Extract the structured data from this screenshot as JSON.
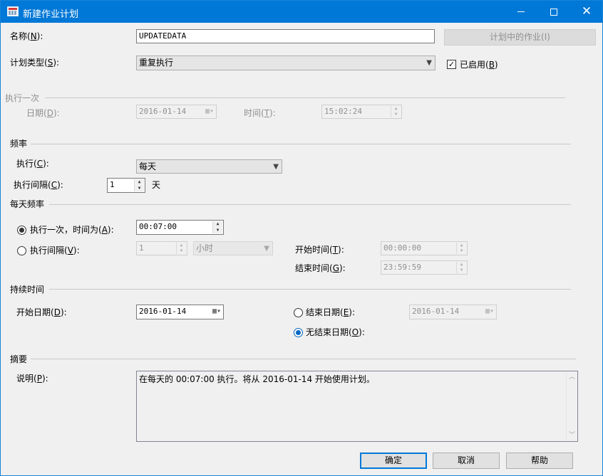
{
  "window": {
    "title": "新建作业计划",
    "minimize": "—",
    "maximize": "□",
    "close": "✕"
  },
  "name": {
    "label": "名称(",
    "key": "N",
    "suffix": "):",
    "value": "UPDATEDATA"
  },
  "jobs_button": "计划中的作业(I)",
  "schedule_type": {
    "label": "计划类型(",
    "key": "S",
    "suffix": "):",
    "value": "重复执行"
  },
  "enabled": {
    "label": "已启用(",
    "key": "B",
    "suffix": ")",
    "checked": true
  },
  "one_time": {
    "header": "执行一次",
    "date_label": "日期(",
    "date_key": "D",
    "date_suffix": "):",
    "date_value": "2016-01-14",
    "time_label": "时间(",
    "time_key": "T",
    "time_suffix": "):",
    "time_value": "15:02:24"
  },
  "frequency": {
    "header": "频率",
    "occurs_label": "执行(",
    "occurs_key": "C",
    "occurs_suffix": "):",
    "occurs_value": "每天",
    "recurs_label": "执行间隔(",
    "recurs_key": "C",
    "recurs_suffix": "):",
    "recurs_value": "1",
    "recurs_unit": "天"
  },
  "daily": {
    "header": "每天频率",
    "once_label": "执行一次，时间为(",
    "once_key": "A",
    "once_suffix": "):",
    "once_value": "00:07:00",
    "every_label": "执行间隔(",
    "every_key": "V",
    "every_suffix": "):",
    "every_value": "1",
    "every_unit": "小时",
    "start_label": "开始时间(",
    "start_key": "T",
    "start_suffix": "):",
    "start_value": "00:00:00",
    "end_label": "结束时间(",
    "end_key": "G",
    "end_suffix": "):",
    "end_value": "23:59:59"
  },
  "duration": {
    "header": "持续时间",
    "start_label": "开始日期(",
    "start_key": "D",
    "start_suffix": "):",
    "start_value": "2016-01-14",
    "end_label": "结束日期(",
    "end_key": "E",
    "end_suffix": "):",
    "end_value": "2016-01-14",
    "noend_label": "无结束日期(",
    "noend_key": "O",
    "noend_suffix": "):"
  },
  "summary": {
    "header": "摘要",
    "desc_label": "说明(",
    "desc_key": "P",
    "desc_suffix": "):",
    "desc_value": "在每天的 00:07:00 执行。将从 2016-01-14 开始使用计划。"
  },
  "buttons": {
    "ok": "确定",
    "cancel": "取消",
    "help": "帮助"
  },
  "icons": {
    "dropdown": "chevron-down-icon",
    "calendar": "calendar-icon",
    "spin": "spin-updown-icon",
    "check": "checkmark-icon"
  }
}
